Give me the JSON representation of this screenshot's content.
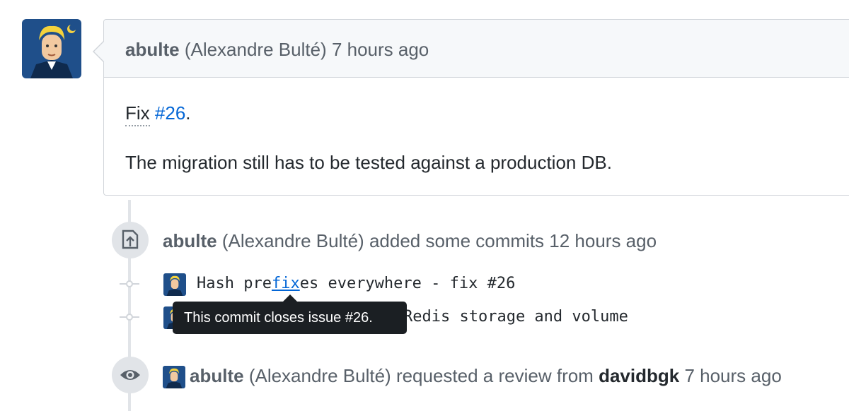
{
  "comment": {
    "author": "abulte",
    "author_full": "(Alexandre Bulté)",
    "time": "7 hours ago",
    "fix_word": "Fix",
    "issue_ref": "#26",
    "period": ".",
    "body_line2": "The migration still has to be tested against a production DB."
  },
  "commits_event": {
    "author": "abulte",
    "author_full": "(Alexandre Bulté)",
    "action": "added some commits",
    "time": "12 hours ago",
    "commits": [
      {
        "prefix": "Hash pre",
        "link": "fix",
        "suffix": "es everywhere - fix #26"
      },
      {
        "visible_text": "Redis storage and volume"
      }
    ]
  },
  "tooltip": {
    "text": "This commit closes issue #26."
  },
  "review_event": {
    "author": "abulte",
    "author_full": "(Alexandre Bulté)",
    "action": "requested a review from",
    "reviewer": "davidbgk",
    "time": "7 hours ago"
  },
  "colors": {
    "link": "#0366d6",
    "tooltip_bg": "#1b1f23",
    "header_bg": "#f6f8fa",
    "border": "#d1d5da"
  },
  "icons": [
    "avatar",
    "commit-push-icon",
    "eye-icon",
    "commit-node-icon"
  ]
}
